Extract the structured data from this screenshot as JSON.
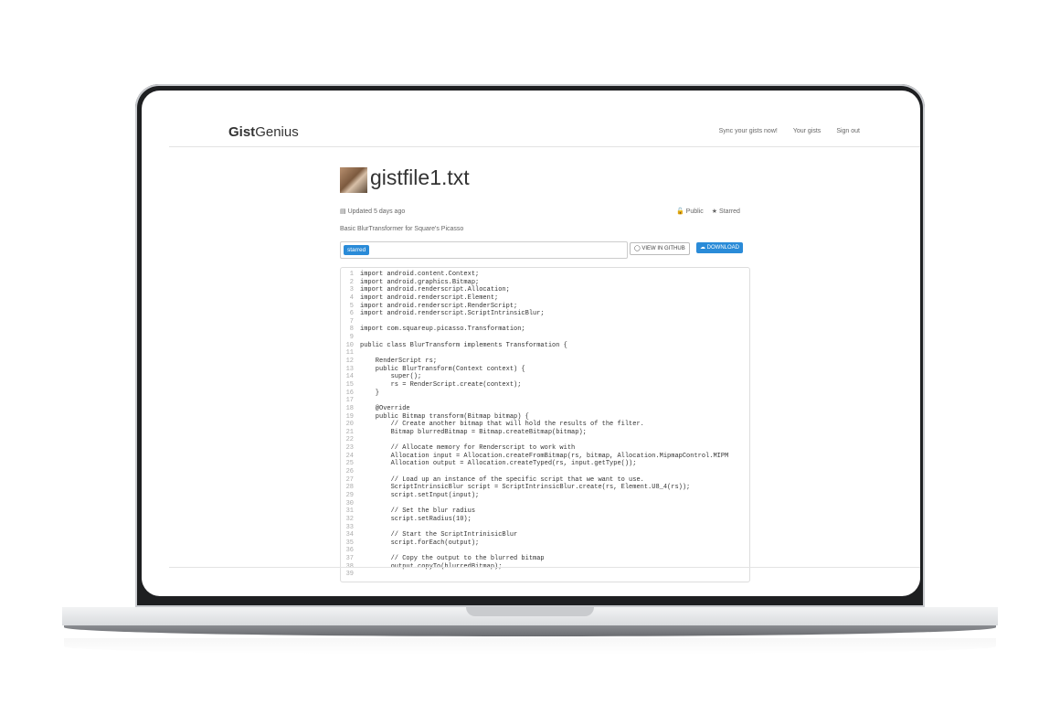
{
  "brand": {
    "bold": "Gist",
    "rest": "Genius"
  },
  "nav": {
    "links": [
      "Sync your gists now!",
      "Your gists",
      "Sign out"
    ]
  },
  "gist": {
    "title": "gistfile1.txt",
    "updated": "Updated 5 days ago",
    "visibility": "Public",
    "starred": "Starred",
    "description": "Basic BlurTransformer for Square's Picasso",
    "tag": "starred",
    "view_github": "VIEW IN GITHUB",
    "download": "DOWNLOAD"
  },
  "icons": {
    "calendar": "calendar-icon",
    "lock": "unlock-icon",
    "star": "star-icon",
    "github": "github-icon",
    "cloud": "cloud-download-icon"
  },
  "code": [
    "import android.content.Context;",
    "import android.graphics.Bitmap;",
    "import android.renderscript.Allocation;",
    "import android.renderscript.Element;",
    "import android.renderscript.RenderScript;",
    "import android.renderscript.ScriptIntrinsicBlur;",
    "",
    "import com.squareup.picasso.Transformation;",
    "",
    "public class BlurTransform implements Transformation {",
    "",
    "    RenderScript rs;",
    "    public BlurTransform(Context context) {",
    "        super();",
    "        rs = RenderScript.create(context);",
    "    }",
    "",
    "    @Override",
    "    public Bitmap transform(Bitmap bitmap) {",
    "        // Create another bitmap that will hold the results of the filter.",
    "        Bitmap blurredBitmap = Bitmap.createBitmap(bitmap);",
    "",
    "        // Allocate memory for Renderscript to work with",
    "        Allocation input = Allocation.createFromBitmap(rs, bitmap, Allocation.MipmapControl.MIPM",
    "        Allocation output = Allocation.createTyped(rs, input.getType());",
    "",
    "        // Load up an instance of the specific script that we want to use.",
    "        ScriptIntrinsicBlur script = ScriptIntrinsicBlur.create(rs, Element.U8_4(rs));",
    "        script.setInput(input);",
    "",
    "        // Set the blur radius",
    "        script.setRadius(10);",
    "",
    "        // Start the ScriptIntrinisicBlur",
    "        script.forEach(output);",
    "",
    "        // Copy the output to the blurred bitmap",
    "        output.copyTo(blurredBitmap);",
    ""
  ]
}
